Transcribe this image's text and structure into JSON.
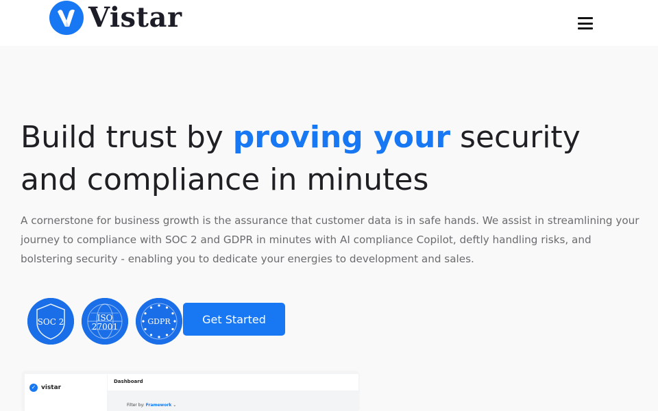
{
  "header": {
    "logo_text": "Vistar",
    "menu_icon": "hamburger-menu-icon"
  },
  "hero": {
    "title_before": "Build trust by ",
    "title_accent": "proving your",
    "title_after": " security and compliance in minutes",
    "description": "A cornerstone for business growth is the assurance that customer data is in safe hands. We assist in streamlining your journey to compliance with SOC 2 and GDPR in minutes with AI compliance Copilot, deftly handling risks, and bolstering security - enabling you to dedicate your energies to development and sales.",
    "cta_label": "Get Started"
  },
  "badges": {
    "soc2": "SOC 2",
    "iso_line1": "ISO",
    "iso_line2": "27001",
    "gdpr": "GDPR"
  },
  "preview": {
    "logo_text": "vistar",
    "heading": "Dashboard",
    "filter_label": "Filter by:",
    "filter_value": "Framework"
  },
  "colors": {
    "accent": "#1877f2",
    "badge_blue": "#1a6fe8",
    "text_dark": "#1f1f24",
    "text_muted": "#6b6b70",
    "background": "#f9f9f9"
  }
}
